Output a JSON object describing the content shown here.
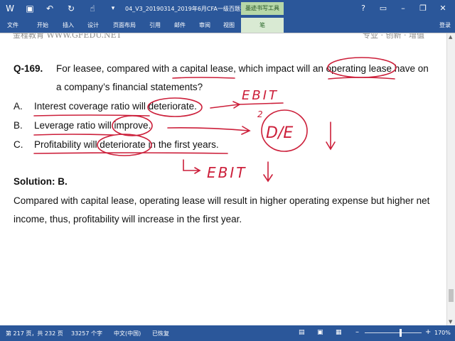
{
  "titlebar": {
    "document_title": "04_V3_20190314_2019年6月CFA一级百题预...",
    "ink_tools_label": "墨迹书写工具",
    "help": "?",
    "login": "登录"
  },
  "tabs": [
    {
      "label": "文件"
    },
    {
      "label": "开始"
    },
    {
      "label": "插入"
    },
    {
      "label": "设计"
    },
    {
      "label": "页面布局"
    },
    {
      "label": "引用"
    },
    {
      "label": "邮件"
    },
    {
      "label": "审阅"
    },
    {
      "label": "视图"
    },
    {
      "label": "笔"
    }
  ],
  "document": {
    "watermark_left": "金程教育 WWW.GFEDU.NET",
    "watermark_right": "专业 · 创新 · 增值",
    "question_number": "Q-169.",
    "question_line1": "For leasee, compared with a capital lease, which impact will an operating lease have on",
    "question_line2": "a company’s financial statements?",
    "options": [
      {
        "letter": "A.",
        "text": "Interest coverage ratio will deteriorate."
      },
      {
        "letter": "B.",
        "text": "Leverage ratio will improve."
      },
      {
        "letter": "C.",
        "text": "Profitability will deteriorate in the first years."
      }
    ],
    "solution_label": "Solution: B.",
    "solution_line1": "Compared with capital lease, operating lease will result in higher operating expense but higher net",
    "solution_line2": "income, thus, profitability will increase in the first year."
  },
  "annotations": {
    "ebit_over_2": "EBIT",
    "two": "2",
    "d_over_e": "D/E",
    "ebit_down": "EBIT"
  },
  "statusbar": {
    "page": "第 217 页，共 232 页",
    "words": "33257 个字",
    "language": "中文(中国)",
    "restored": "已恢复",
    "zoom": "170%"
  },
  "colors": {
    "ribbon_blue": "#2b579a",
    "ink_red": "#cc1f3a"
  }
}
